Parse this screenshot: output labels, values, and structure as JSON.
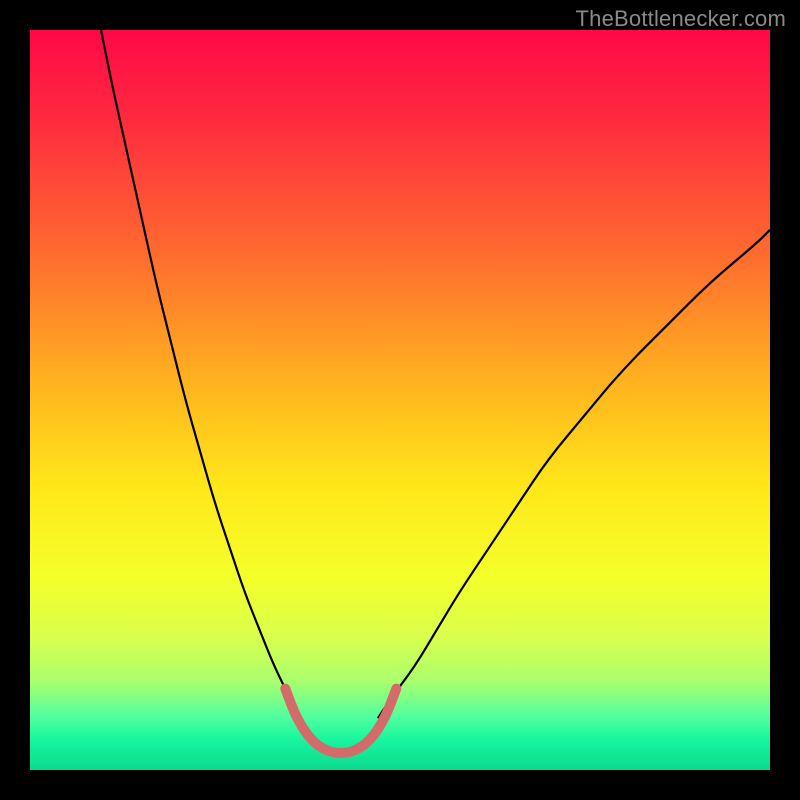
{
  "watermark": {
    "text": "TheBottlenecker.com"
  },
  "chart_data": {
    "type": "line",
    "title": "",
    "xlabel": "",
    "ylabel": "",
    "xlim": [
      0,
      100
    ],
    "ylim": [
      0,
      100
    ],
    "grid": false,
    "gradient_stops": [
      {
        "offset": 0,
        "color": "#ff0846"
      },
      {
        "offset": 12,
        "color": "#ff2a3f"
      },
      {
        "offset": 30,
        "color": "#ff6a2f"
      },
      {
        "offset": 48,
        "color": "#ffb41e"
      },
      {
        "offset": 62,
        "color": "#ffe81a"
      },
      {
        "offset": 74,
        "color": "#f4ff2a"
      },
      {
        "offset": 82,
        "color": "#d9ff4c"
      },
      {
        "offset": 88,
        "color": "#aaff6e"
      },
      {
        "offset": 93,
        "color": "#4dffa0"
      },
      {
        "offset": 96,
        "color": "#17f59d"
      },
      {
        "offset": 100,
        "color": "#0cd98e"
      }
    ],
    "series": [
      {
        "name": "left-curve",
        "stroke": "#000000",
        "stroke_width": 2.2,
        "x": [
          9.6,
          11,
          13,
          15,
          17,
          19,
          21,
          23,
          25,
          27,
          29,
          31,
          33,
          35,
          36.5
        ],
        "y": [
          100,
          93,
          84,
          75,
          66,
          58,
          50,
          43,
          36,
          30,
          24,
          19,
          14,
          10,
          7
        ]
      },
      {
        "name": "right-curve",
        "stroke": "#000000",
        "stroke_width": 2.2,
        "x": [
          47,
          49,
          52,
          55,
          58,
          62,
          66,
          70,
          75,
          80,
          86,
          92,
          98,
          100
        ],
        "y": [
          7,
          10,
          14,
          19,
          24,
          30,
          36,
          42,
          48,
          54,
          60,
          66,
          71,
          73
        ]
      },
      {
        "name": "u-bottom-highlight",
        "stroke": "#d46b6b",
        "stroke_width": 10,
        "linecap": "round",
        "x": [
          34.5,
          36,
          38,
          40,
          42,
          44,
          46,
          48,
          49.5
        ],
        "y": [
          11,
          7,
          4,
          2.6,
          2.2,
          2.6,
          4,
          7,
          11
        ]
      }
    ]
  }
}
